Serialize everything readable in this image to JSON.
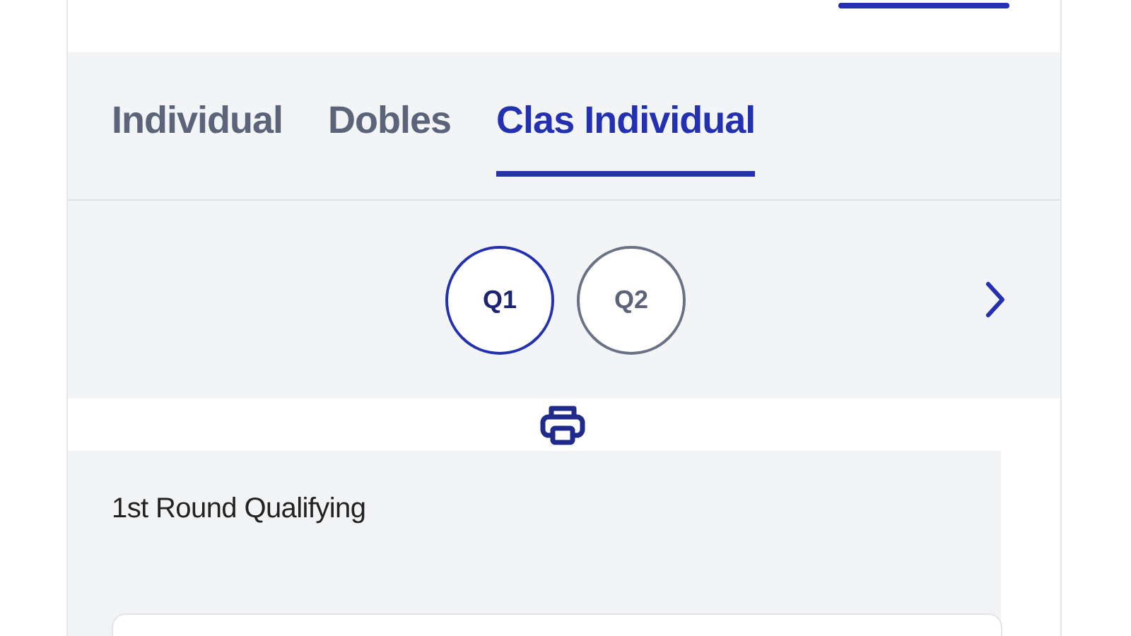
{
  "tabs": [
    {
      "label": "Individual",
      "selected": false
    },
    {
      "label": "Dobles",
      "selected": false
    },
    {
      "label": "Clas Individual",
      "selected": true
    }
  ],
  "rounds": [
    {
      "label": "Q1",
      "selected": true
    },
    {
      "label": "Q2",
      "selected": false
    }
  ],
  "section": {
    "title": "1st Round Qualifying"
  }
}
